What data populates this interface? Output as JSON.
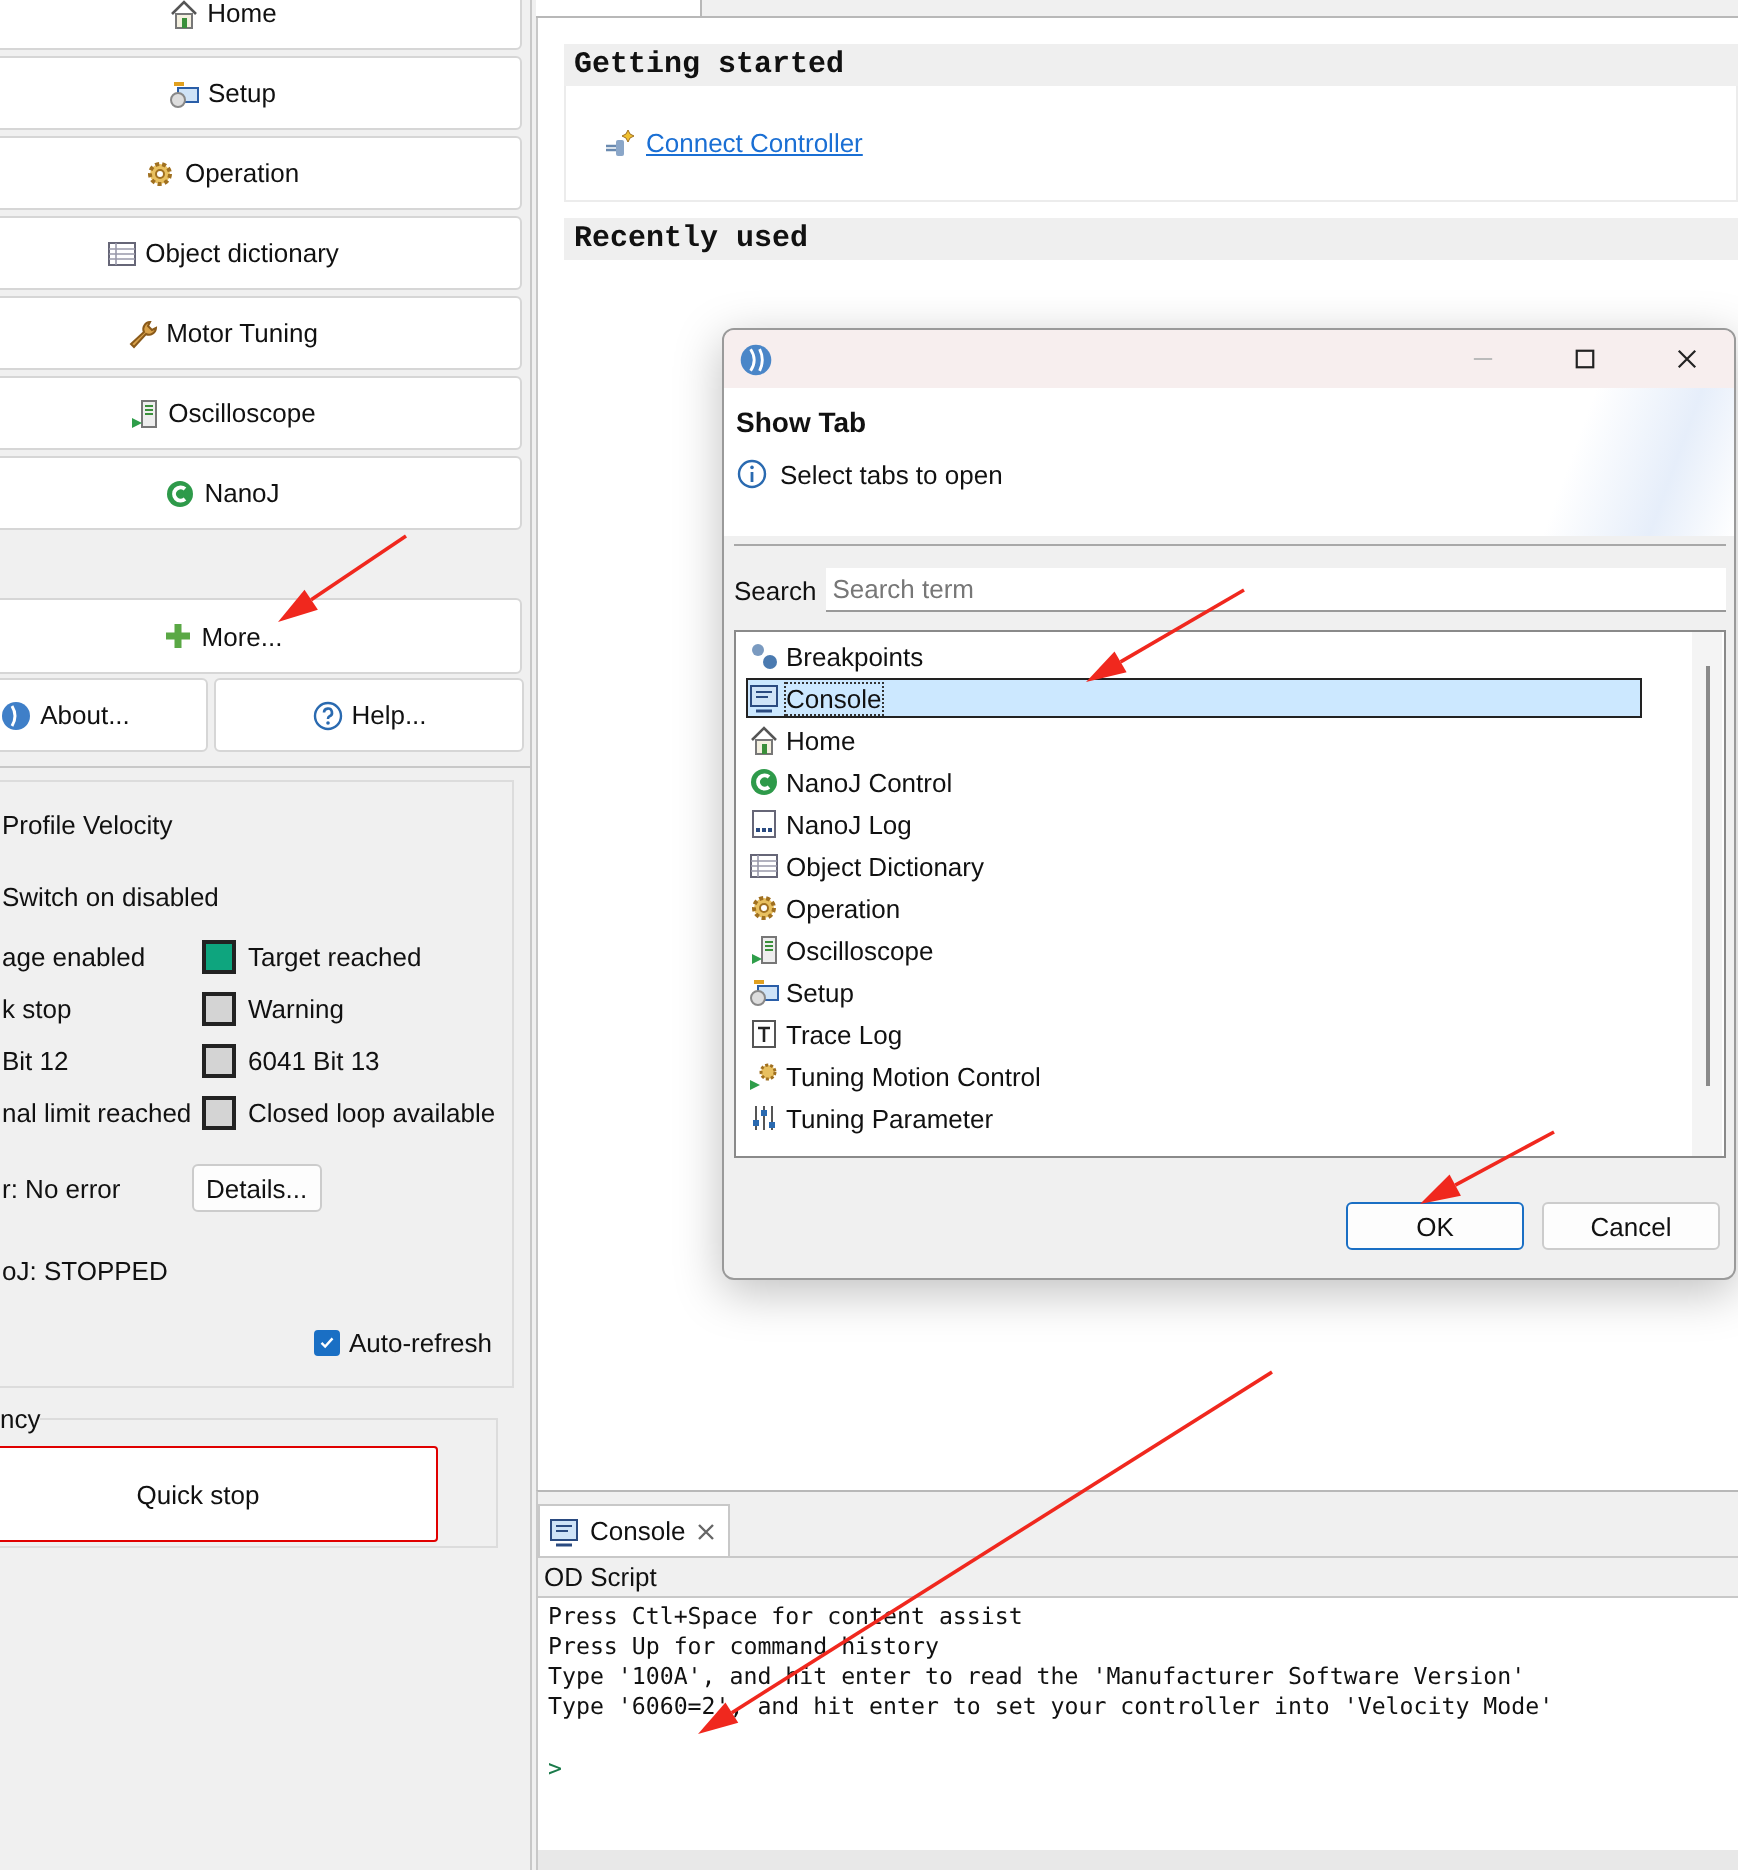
{
  "nav_buttons": [
    "Home",
    "Setup",
    "Operation",
    "Object dictionary",
    "Motor Tuning",
    "Oscilloscope",
    "NanoJ"
  ],
  "more_button": "More...",
  "about_button": "About...",
  "help_button": "Help...",
  "status": {
    "mode": "Profile Velocity",
    "state": "Switch on disabled",
    "left_labels": [
      "age enabled",
      "k stop",
      "Bit 12",
      "nal limit reached"
    ],
    "indicators": [
      {
        "label": "Target reached",
        "on": true
      },
      {
        "label": "Warning",
        "on": false
      },
      {
        "label": "6041 Bit 13",
        "on": false
      },
      {
        "label": "Closed loop available",
        "on": false
      }
    ],
    "error": "r: No error",
    "details_button": "Details...",
    "nanoj": "oJ: STOPPED",
    "auto_refresh": {
      "label": "Auto-refresh",
      "checked": true
    }
  },
  "emergency": {
    "legend": "ncy",
    "button": "Quick stop"
  },
  "editor": {
    "sections": [
      {
        "title": "Getting started",
        "links": [
          "Connect Controller"
        ]
      },
      {
        "title": "Recently used"
      }
    ]
  },
  "console": {
    "tab": "Console",
    "title": "OD Script",
    "lines": [
      "Press Ctl+Space for content assist",
      "Press Up for command history",
      "Type '100A', and hit enter to read the 'Manufacturer Software Version'",
      "Type '6060=2', and hit enter to set your controller into 'Velocity Mode'"
    ],
    "prompt": ">"
  },
  "dialog": {
    "title": "Show Tab",
    "message": "Select tabs to open",
    "search_label": "Search",
    "search": {
      "placeholder": "Search term"
    },
    "items": [
      {
        "label": "Breakpoints",
        "selected": false
      },
      {
        "label": "Console",
        "selected": true
      },
      {
        "label": "Home",
        "selected": false
      },
      {
        "label": "NanoJ Control",
        "selected": false
      },
      {
        "label": "NanoJ Log",
        "selected": false
      },
      {
        "label": "Object Dictionary",
        "selected": false
      },
      {
        "label": "Operation",
        "selected": false
      },
      {
        "label": "Oscilloscope",
        "selected": false
      },
      {
        "label": "Setup",
        "selected": false
      },
      {
        "label": "Trace Log",
        "selected": false
      },
      {
        "label": "Tuning Motion Control",
        "selected": false
      },
      {
        "label": "Tuning Parameter",
        "selected": false
      }
    ],
    "buttons": [
      {
        "label": "OK",
        "default": true
      },
      {
        "label": "Cancel",
        "default": false
      }
    ]
  }
}
